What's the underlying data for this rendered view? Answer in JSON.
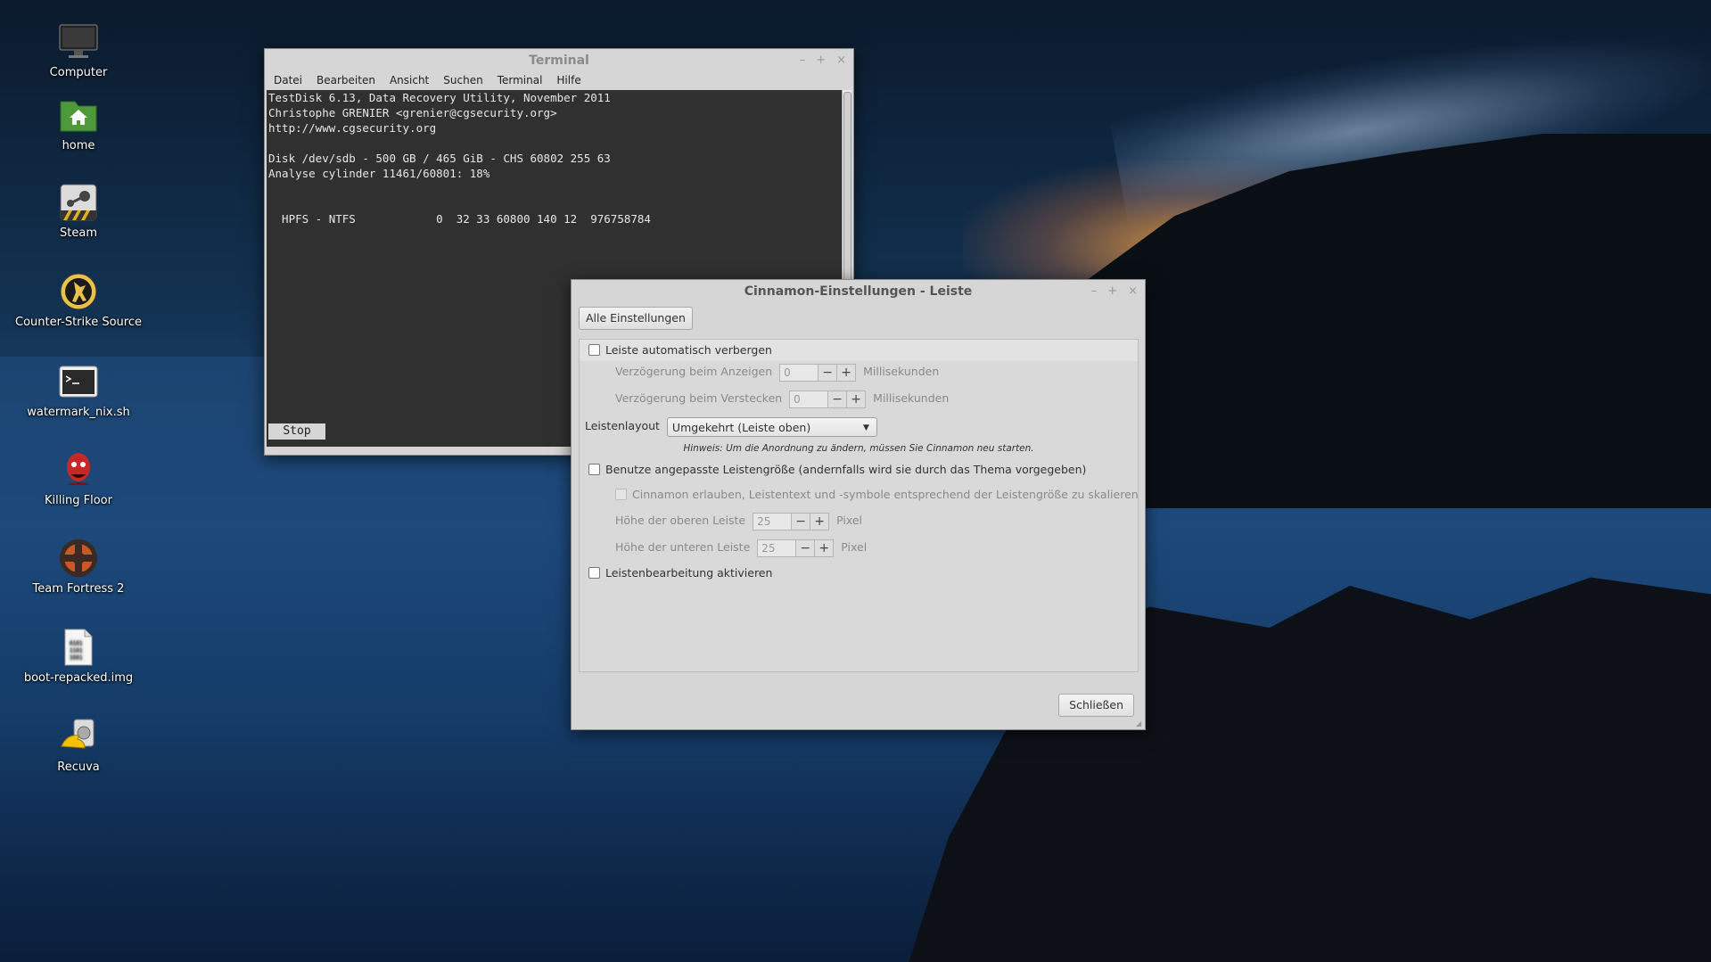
{
  "desktop": {
    "icons": [
      {
        "label": "Computer",
        "icon": "monitor-icon"
      },
      {
        "label": "home",
        "icon": "home-folder-icon"
      },
      {
        "label": "Steam",
        "icon": "steam-icon"
      },
      {
        "label": "Counter-Strike Source",
        "icon": "counter-strike-icon"
      },
      {
        "label": "watermark_nix.sh",
        "icon": "terminal-script-icon"
      },
      {
        "label": "Killing Floor",
        "icon": "killing-floor-icon"
      },
      {
        "label": "Team Fortress 2",
        "icon": "team-fortress-icon"
      },
      {
        "label": "boot-repacked.img",
        "icon": "disk-image-icon"
      },
      {
        "label": "Recuva",
        "icon": "recuva-icon"
      }
    ]
  },
  "terminal": {
    "title": "Terminal",
    "menu": [
      "Datei",
      "Bearbeiten",
      "Ansicht",
      "Suchen",
      "Terminal",
      "Hilfe"
    ],
    "lines": [
      "TestDisk 6.13, Data Recovery Utility, November 2011",
      "Christophe GRENIER <grenier@cgsecurity.org>",
      "http://www.cgsecurity.org",
      "",
      "Disk /dev/sdb - 500 GB / 465 GiB - CHS 60802 255 63",
      "Analyse cylinder 11461/60801: 18%",
      "",
      "",
      "  HPFS - NTFS            0  32 33 60800 140 12  976758784"
    ],
    "stop_label": "Stop"
  },
  "settings": {
    "title": "Cinnamon-Einstellungen - Leiste",
    "all_settings_label": "Alle Einstellungen",
    "autohide_label": "Leiste automatisch verbergen",
    "show_delay_label": "Verzögerung beim Anzeigen",
    "show_delay_value": "0",
    "hide_delay_label": "Verzögerung beim Verstecken",
    "hide_delay_value": "0",
    "ms_unit": "Millisekunden",
    "layout_label": "Leistenlayout",
    "layout_value": "Umgekehrt (Leiste oben)",
    "hint": "Hinweis: Um die Anordnung zu ändern, müssen Sie Cinnamon neu starten.",
    "custom_size_label": "Benutze angepasste Leistengröße (andernfalls wird sie durch das Thema vorgegeben)",
    "scale_label": "Cinnamon erlauben, Leistentext und -symbole entsprechend der Leistengröße zu skalieren",
    "top_height_label": "Höhe der oberen Leiste",
    "top_height_value": "25",
    "bottom_height_label": "Höhe der unteren Leiste",
    "bottom_height_value": "25",
    "px_unit": "Pixel",
    "edit_mode_label": "Leistenbearbeitung aktivieren",
    "close_label": "Schließen"
  }
}
